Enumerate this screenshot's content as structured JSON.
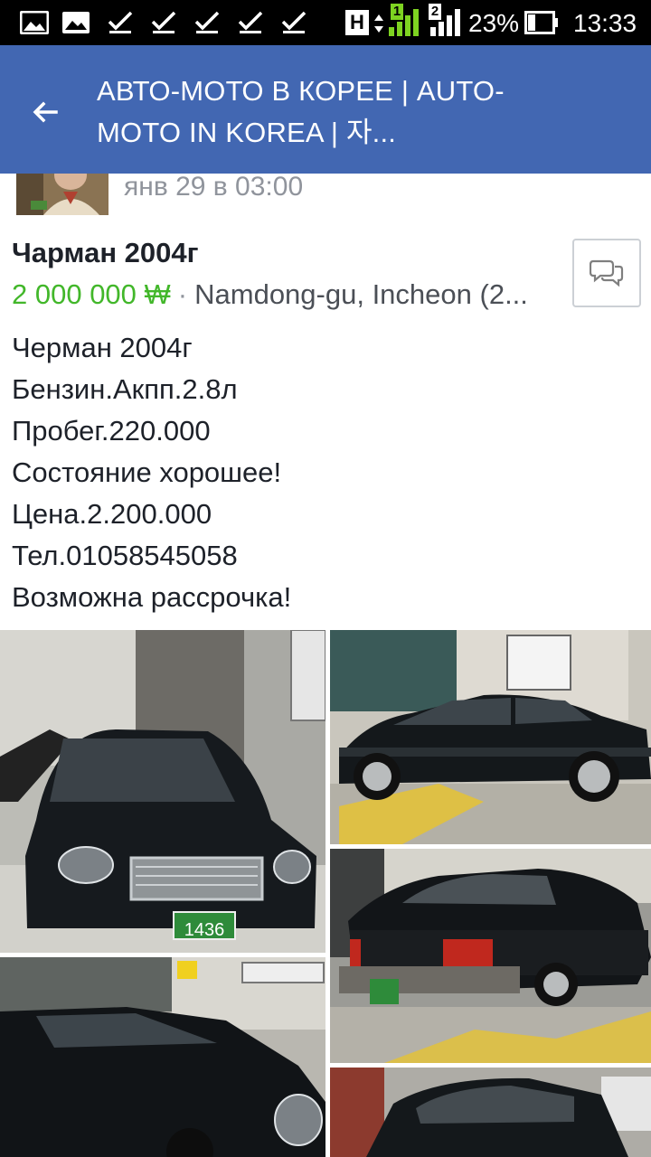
{
  "status_bar": {
    "network_badge": "H",
    "sim1": "1",
    "sim2": "2",
    "battery": "23%",
    "time": "13:33",
    "notification_icons": [
      "gallery-icon",
      "check-icon",
      "check-icon",
      "check-icon",
      "check-icon",
      "check-icon"
    ]
  },
  "app_bar": {
    "back_icon": "arrow-left-icon",
    "title": "АВТО-МОТО В КОРЕЕ | AUTO-MOTO IN KOREA | 자..."
  },
  "post": {
    "time": "янв 29 в 03:00",
    "listing_title": "Чарман 2004г",
    "price": "2 000 000 ₩",
    "separator": "·",
    "location": "Namdong-gu, Incheon (2...",
    "message_icon": "chat-bubbles-icon",
    "description": [
      "Черман 2004г",
      "Бензин.Акпп.2.8л",
      "Пробег.220.000",
      "Состояние хорошее!",
      "Цена.2.200.000",
      "Тел.01058545058",
      "Возможна рассрочка!"
    ],
    "plate_number": "1436"
  },
  "colors": {
    "app_bar": "#4267b2",
    "price": "#42b72a",
    "meta_text": "#90949c",
    "body_text": "#1d2129"
  }
}
